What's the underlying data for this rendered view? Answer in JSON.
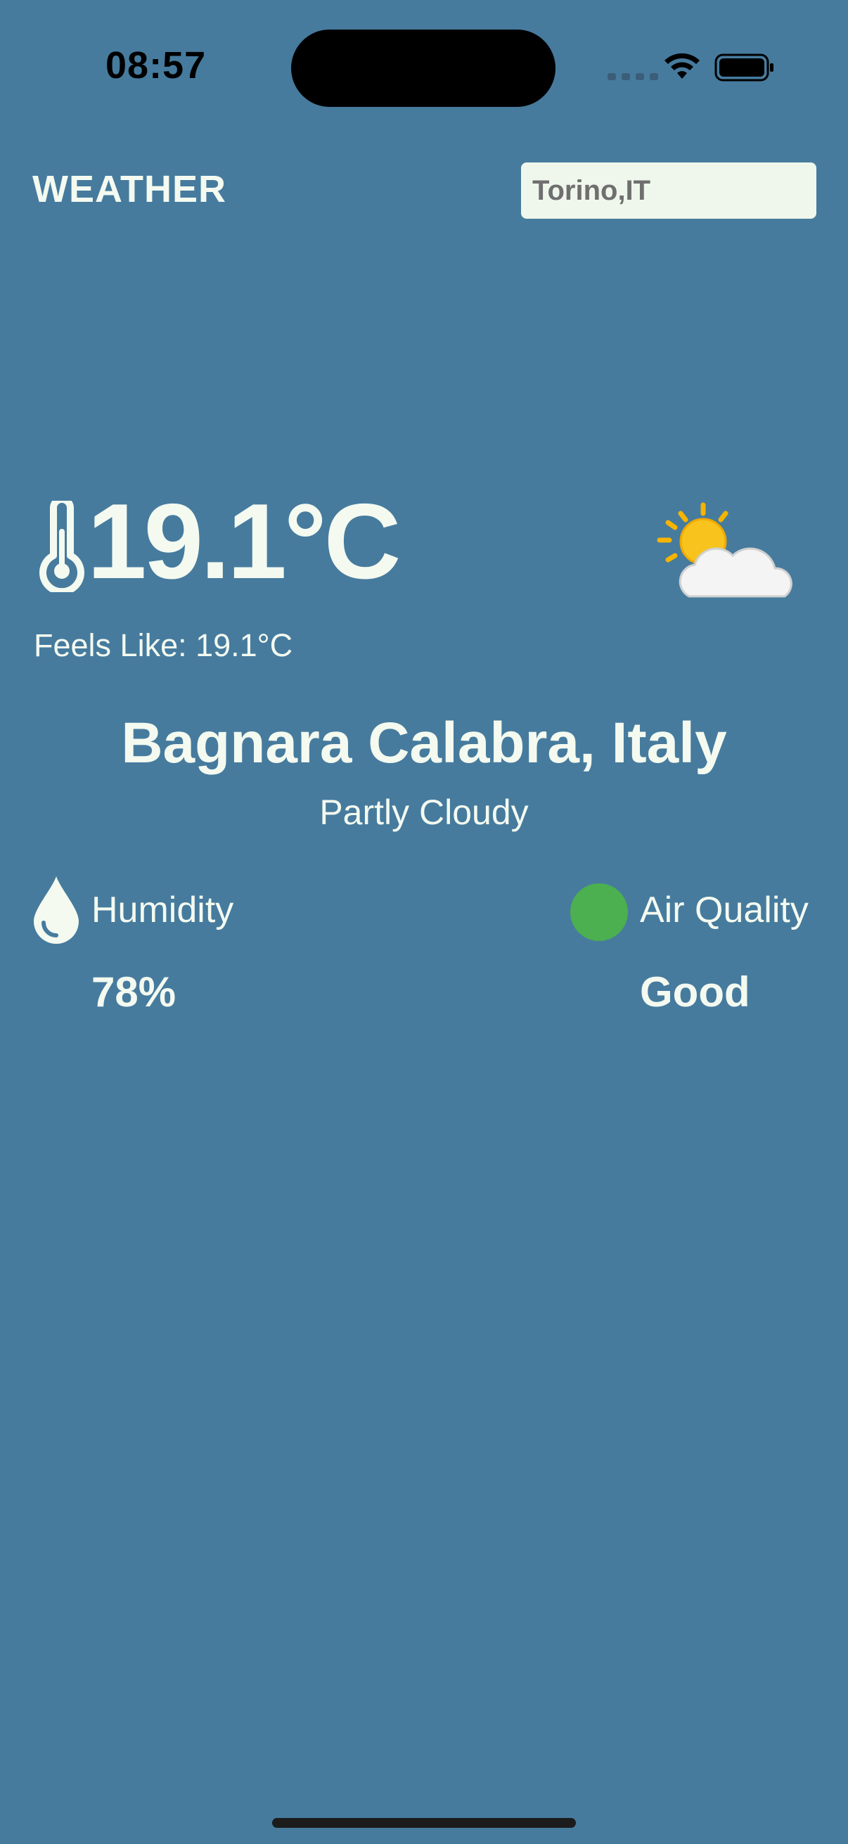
{
  "status_bar": {
    "time": "08:57"
  },
  "header": {
    "title": "WEATHER",
    "search_value": "Torino,IT"
  },
  "current": {
    "temperature": "19.1°C",
    "feels_like": "Feels Like: 19.1°C",
    "location": "Bagnara Calabra, Italy",
    "condition": "Partly Cloudy",
    "icon": "partly-cloudy-icon"
  },
  "metrics": {
    "humidity": {
      "label": "Humidity",
      "value": "78%",
      "icon": "water-drop-icon"
    },
    "air_quality": {
      "label": "Air Quality",
      "value": "Good",
      "color": "#4caf50"
    }
  },
  "colors": {
    "background": "#467b9e",
    "text": "#f1f8ea",
    "input_background": "#eff7ec"
  }
}
